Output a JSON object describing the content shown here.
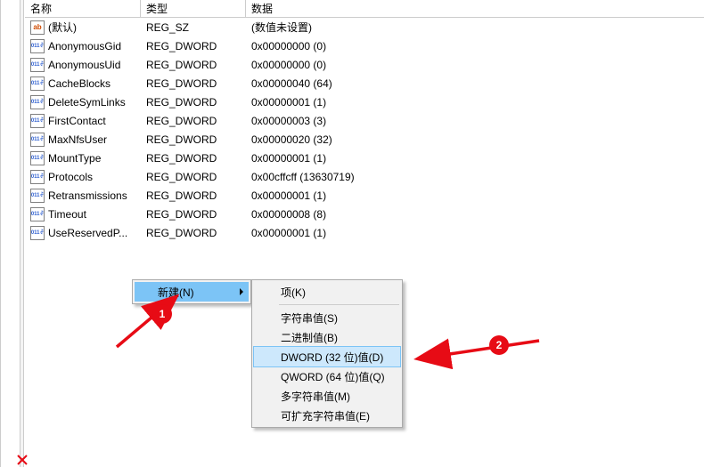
{
  "columns": {
    "name": "名称",
    "type": "类型",
    "data": "数据"
  },
  "rows": [
    {
      "icon": "string",
      "name": "(默认)",
      "type": "REG_SZ",
      "data": "(数值未设置)"
    },
    {
      "icon": "binary",
      "name": "AnonymousGid",
      "type": "REG_DWORD",
      "data": "0x00000000 (0)"
    },
    {
      "icon": "binary",
      "name": "AnonymousUid",
      "type": "REG_DWORD",
      "data": "0x00000000 (0)"
    },
    {
      "icon": "binary",
      "name": "CacheBlocks",
      "type": "REG_DWORD",
      "data": "0x00000040 (64)"
    },
    {
      "icon": "binary",
      "name": "DeleteSymLinks",
      "type": "REG_DWORD",
      "data": "0x00000001 (1)"
    },
    {
      "icon": "binary",
      "name": "FirstContact",
      "type": "REG_DWORD",
      "data": "0x00000003 (3)"
    },
    {
      "icon": "binary",
      "name": "MaxNfsUser",
      "type": "REG_DWORD",
      "data": "0x00000020 (32)"
    },
    {
      "icon": "binary",
      "name": "MountType",
      "type": "REG_DWORD",
      "data": "0x00000001 (1)"
    },
    {
      "icon": "binary",
      "name": "Protocols",
      "type": "REG_DWORD",
      "data": "0x00cffcff (13630719)"
    },
    {
      "icon": "binary",
      "name": "Retransmissions",
      "type": "REG_DWORD",
      "data": "0x00000001 (1)"
    },
    {
      "icon": "binary",
      "name": "Timeout",
      "type": "REG_DWORD",
      "data": "0x00000008 (8)"
    },
    {
      "icon": "binary",
      "name": "UseReservedP...",
      "type": "REG_DWORD",
      "data": "0x00000001 (1)"
    }
  ],
  "context_menu_l1": {
    "items": [
      {
        "id": "new",
        "label": "新建(N)",
        "hasSubmenu": true,
        "isHover": true
      }
    ]
  },
  "context_menu_l2": {
    "items": [
      {
        "id": "key",
        "label": "项(K)",
        "isHover": false,
        "sepAfter": true
      },
      {
        "id": "string",
        "label": "字符串值(S)",
        "isHover": false
      },
      {
        "id": "binary",
        "label": "二进制值(B)",
        "isHover": false
      },
      {
        "id": "dword",
        "label": "DWORD (32 位)值(D)",
        "isHover": true
      },
      {
        "id": "qword",
        "label": "QWORD (64 位)值(Q)",
        "isHover": false
      },
      {
        "id": "multi",
        "label": "多字符串值(M)",
        "isHover": false
      },
      {
        "id": "expand",
        "label": "可扩充字符串值(E)",
        "isHover": false
      }
    ]
  },
  "annotations": {
    "one": "1",
    "two": "2",
    "x_mark": "×",
    "color": "#e70b15"
  }
}
